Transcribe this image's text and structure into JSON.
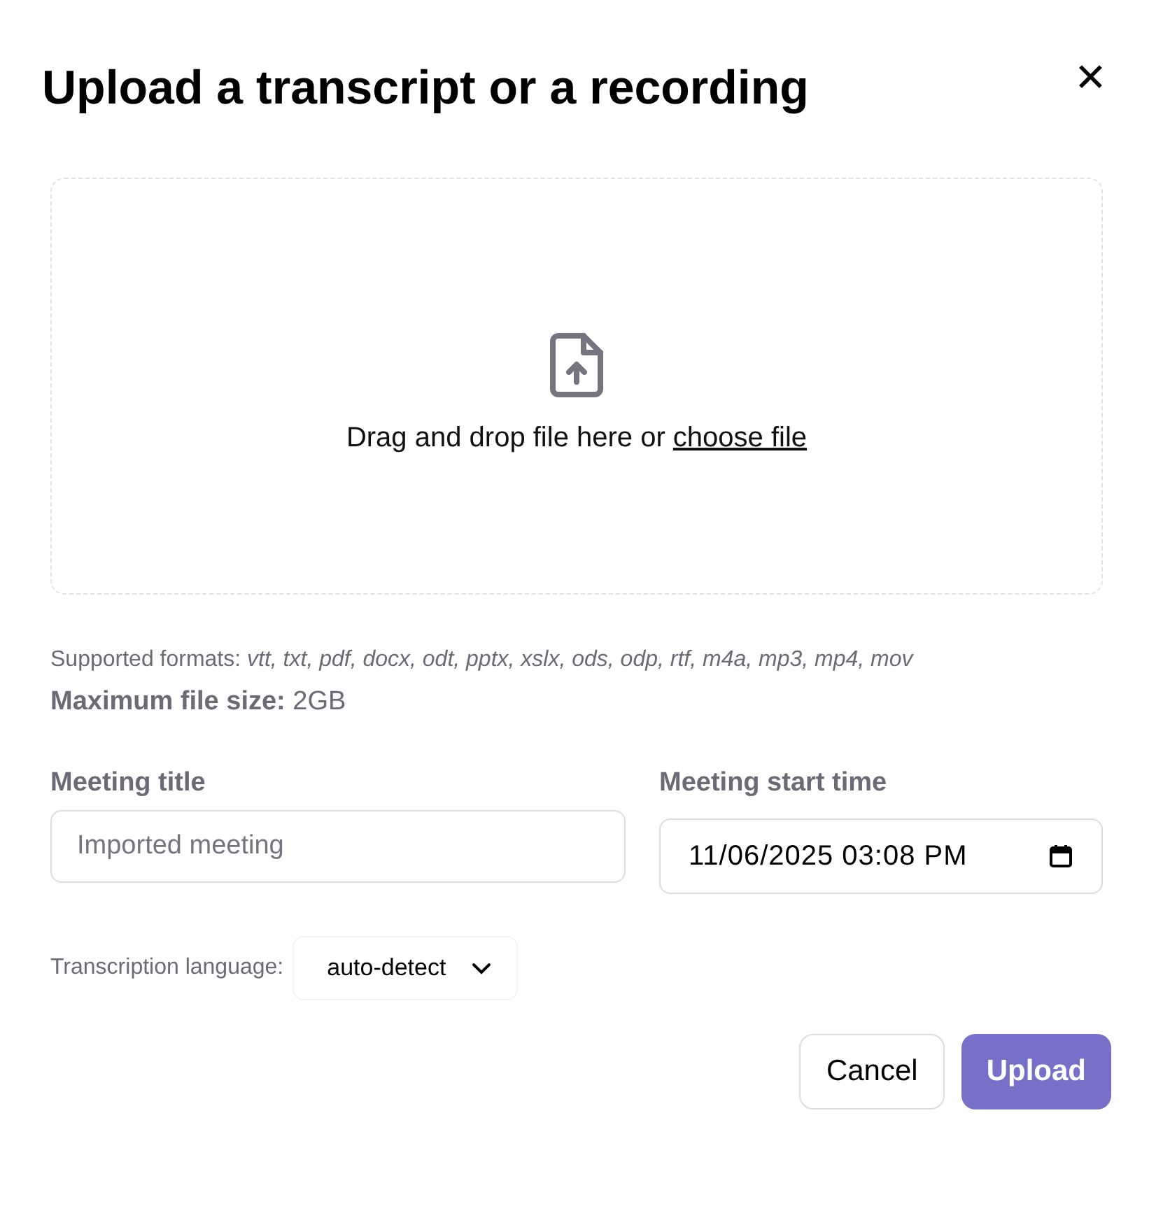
{
  "dialog": {
    "title": "Upload a transcript or a recording",
    "close_label": "✕"
  },
  "dropzone": {
    "text": "Drag and drop file here or",
    "link": "choose file"
  },
  "supported_formats": "Supported formats: *vtt, txt, pdf, docx, odt, pptx, xslx, ods, odp, rtf, m4a, mp3, mp4, mov*",
  "max_size": "**Maximum file size:** 2GB",
  "meeting_title": {
    "label": "Meeting title",
    "placeholder": "Imported meeting"
  },
  "start_time": {
    "label": "Meeting start time",
    "value": "11/06/2025 03:08 PM"
  },
  "language": {
    "label": "Transcription language:",
    "value": "auto-detect"
  },
  "buttons": [
    {
      "label": "Cancel",
      "kind": "secondary"
    },
    {
      "label": "Upload",
      "kind": "primary"
    }
  ]
}
